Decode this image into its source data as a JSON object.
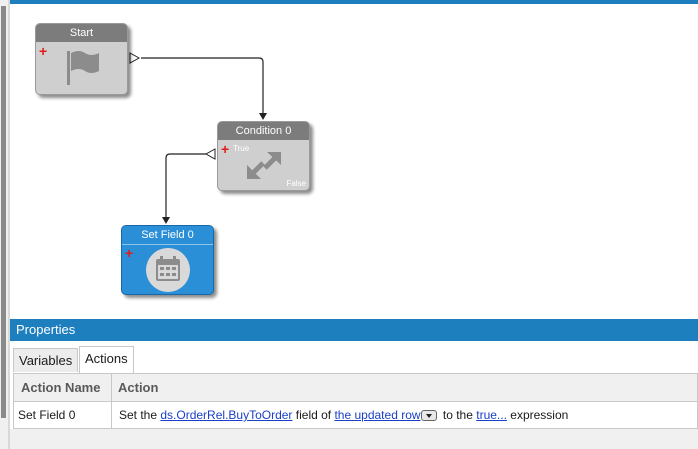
{
  "workflow": {
    "nodes": {
      "start": {
        "title": "Start",
        "icon": "flag-icon"
      },
      "condition": {
        "title": "Condition 0",
        "true_label": "True",
        "false_label": "False",
        "icon": "arrows-icon"
      },
      "setfield": {
        "title": "Set Field 0",
        "icon": "calendar-icon"
      }
    }
  },
  "properties": {
    "title": "Properties",
    "tabs": [
      {
        "label": "Variables",
        "active": false
      },
      {
        "label": "Actions",
        "active": true
      }
    ],
    "grid": {
      "columns": [
        "Action Name",
        "Action"
      ],
      "rows": [
        {
          "name": "Set Field 0",
          "action": {
            "pre": "Set the",
            "field_link": "ds.OrderRel.BuyToOrder",
            "mid": "field of",
            "row_link": "the updated row",
            "post": "to the",
            "expr_link": "true...",
            "tail": "expression"
          }
        }
      ]
    }
  },
  "colors": {
    "accent": "#1e7fbf",
    "node_blue": "#2a8fd6",
    "node_gray": "#cfcfcf",
    "link": "#1a3fc8"
  }
}
